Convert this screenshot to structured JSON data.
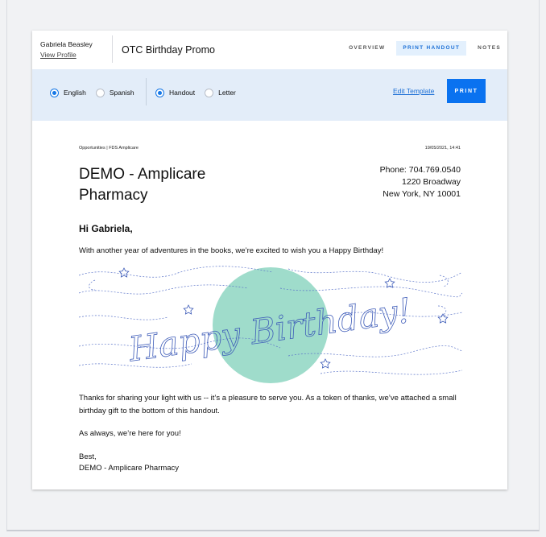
{
  "header": {
    "user_name": "Gabriela Beasley",
    "view_profile": "View Profile",
    "title": "OTC Birthday Promo",
    "tabs": [
      {
        "label": "OVERVIEW",
        "active": false
      },
      {
        "label": "PRINT HANDOUT",
        "active": true
      },
      {
        "label": "NOTES",
        "active": false
      }
    ]
  },
  "toolbar": {
    "language_options": [
      {
        "label": "English",
        "checked": true
      },
      {
        "label": "Spanish",
        "checked": false
      }
    ],
    "format_options": [
      {
        "label": "Handout",
        "checked": true
      },
      {
        "label": "Letter",
        "checked": false
      }
    ],
    "edit_template": "Edit Template",
    "print_label": "PRINT"
  },
  "document": {
    "breadcrumb": "Opportunities | FDS Amplicare",
    "timestamp": "19/05/2021, 14:41",
    "pharmacy_name": "DEMO - Amplicare Pharmacy",
    "contact": {
      "phone": "Phone: 704.769.0540",
      "address_line1": "1220 Broadway",
      "address_line2": "New York, NY 10001"
    },
    "greeting": "Hi Gabriela,",
    "paragraph1": "With another year of adventures in the books, we’re excited to wish you a Happy Birthday!",
    "banner_text": "Happy Birthday!",
    "paragraph2": "Thanks for sharing your light with us -- it’s a pleasure to serve you. As a token of thanks, we’ve attached a small birthday gift to the bottom of this handout.",
    "paragraph3": "As always, we’re here for you!",
    "signoff": "Best,",
    "signature": "DEMO - Amplicare Pharmacy"
  },
  "colors": {
    "accent": "#0a72f0",
    "toolbar_bg": "#e3edf9",
    "banner_circle": "#9fdccb",
    "banner_ink": "#3d5bb8"
  }
}
